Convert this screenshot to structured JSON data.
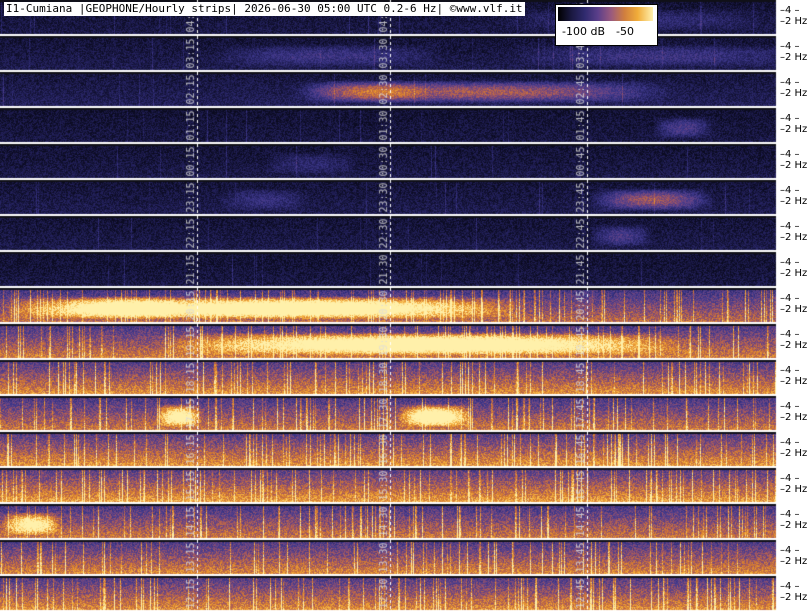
{
  "title": "I1-Cumiana |GEOPHONE/Hourly strips| 2026-06-30 05:00 UTC 0.2-6 Hz| ©www.vlf.it",
  "scale": {
    "low_label": "-100 dB",
    "high_label": "-50"
  },
  "axis": {
    "upper_label": "4",
    "lower_label": "2 Hz"
  },
  "colors": {
    "background": "#ffffff",
    "separator": "#101018",
    "quiet": "#2a2a6a",
    "active": "#f0a030",
    "marker": "#ffffff"
  },
  "strips": [
    {
      "times": [
        "04:15",
        "04:30",
        "04:45"
      ],
      "activity": 0.15,
      "bursts": [
        [
          0.82,
          0.18,
          0.3
        ]
      ]
    },
    {
      "times": [
        "03:15",
        "03:30",
        "03:45"
      ],
      "activity": 0.18,
      "bursts": [
        [
          0.42,
          0.15,
          0.35
        ],
        [
          0.85,
          0.2,
          0.35
        ]
      ]
    },
    {
      "times": [
        "02:15",
        "02:30",
        "02:45"
      ],
      "activity": 0.22,
      "bursts": [
        [
          0.62,
          0.25,
          0.8
        ],
        [
          0.47,
          0.08,
          0.45
        ]
      ]
    },
    {
      "times": [
        "01:15",
        "01:30",
        "01:45"
      ],
      "activity": 0.14,
      "bursts": [
        [
          0.88,
          0.04,
          0.5
        ]
      ]
    },
    {
      "times": [
        "00:15",
        "00:30",
        "00:45"
      ],
      "activity": 0.16,
      "bursts": [
        [
          0.4,
          0.06,
          0.25
        ]
      ]
    },
    {
      "times": [
        "23:15",
        "23:30",
        "23:45"
      ],
      "activity": 0.18,
      "bursts": [
        [
          0.84,
          0.08,
          0.8
        ],
        [
          0.34,
          0.06,
          0.3
        ]
      ]
    },
    {
      "times": [
        "22:15",
        "22:30",
        "22:45"
      ],
      "activity": 0.17,
      "bursts": [
        [
          0.8,
          0.04,
          0.45
        ]
      ]
    },
    {
      "times": [
        "21:15",
        "21:30",
        "21:45"
      ],
      "activity": 0.14,
      "bursts": []
    },
    {
      "times": [
        "20:15",
        "20:30",
        "20:45"
      ],
      "activity": 0.62,
      "bursts": [
        [
          0.38,
          0.3,
          0.95
        ],
        [
          0.12,
          0.12,
          0.6
        ]
      ]
    },
    {
      "times": [
        "19:15",
        "19:30",
        "19:45"
      ],
      "activity": 0.68,
      "bursts": [
        [
          0.55,
          0.35,
          0.85
        ]
      ]
    },
    {
      "times": [
        "18:15",
        "18:30",
        "18:45"
      ],
      "activity": 0.72,
      "bursts": []
    },
    {
      "times": [
        "17:15",
        "17:30",
        "17:45"
      ],
      "activity": 0.66,
      "bursts": [
        [
          0.56,
          0.05,
          0.85
        ],
        [
          0.23,
          0.03,
          0.75
        ]
      ]
    },
    {
      "times": [
        "16:15",
        "16:30",
        "16:45"
      ],
      "activity": 0.74,
      "bursts": []
    },
    {
      "times": [
        "15:15",
        "15:30",
        "15:45"
      ],
      "activity": 0.76,
      "bursts": []
    },
    {
      "times": [
        "14:15",
        "14:30",
        "14:45"
      ],
      "activity": 0.66,
      "bursts": [
        [
          0.04,
          0.04,
          0.7
        ]
      ]
    },
    {
      "times": [
        "13:15",
        "13:30",
        "13:45"
      ],
      "activity": 0.7,
      "bursts": []
    },
    {
      "times": [
        "12:15",
        "12:30",
        "12:45"
      ],
      "activity": 0.72,
      "bursts": []
    }
  ]
}
